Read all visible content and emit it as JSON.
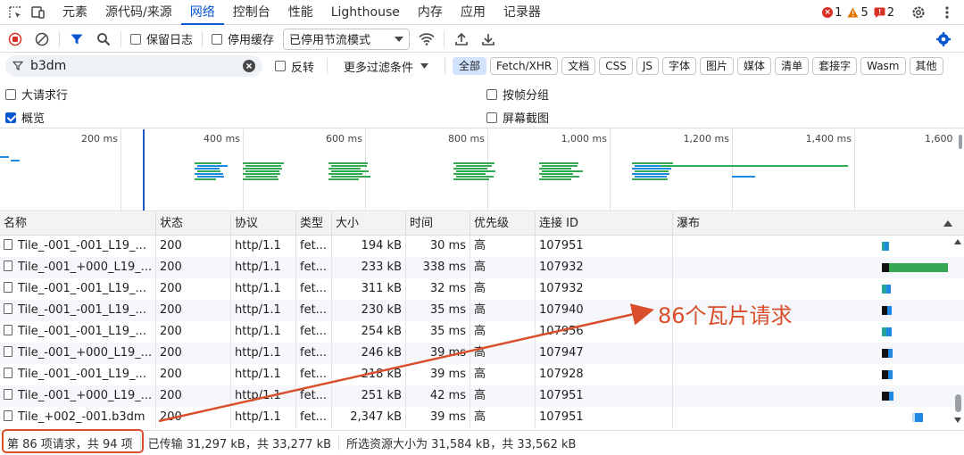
{
  "tabbar": {
    "tabs": [
      {
        "label": "元素"
      },
      {
        "label": "源代码/来源"
      },
      {
        "label": "网络",
        "active": true
      },
      {
        "label": "控制台"
      },
      {
        "label": "性能"
      },
      {
        "label": "Lighthouse"
      },
      {
        "label": "内存"
      },
      {
        "label": "应用"
      },
      {
        "label": "记录器"
      }
    ],
    "errors": "1",
    "warnings": "5",
    "issues": "2",
    "colors": {
      "error": "#d93025",
      "warning": "#e37400",
      "active": "#0b57d0"
    }
  },
  "toolbar": {
    "preserve_log": "保留日志",
    "disable_cache": "停用缓存",
    "throttle": "已停用节流模式"
  },
  "filterbar": {
    "search_value": "b3dm",
    "invert": "反转",
    "more_filters": "更多过滤条件",
    "chips": [
      "全部",
      "Fetch/XHR",
      "文档",
      "CSS",
      "JS",
      "字体",
      "图片",
      "媒体",
      "清单",
      "套接字",
      "Wasm",
      "其他"
    ]
  },
  "options": {
    "large_rows": "大请求行",
    "overview": "概览",
    "group_by_frame": "按帧分组",
    "screenshots": "屏幕截图"
  },
  "overview": {
    "ticks": [
      "200 ms",
      "400 ms",
      "600 ms",
      "800 ms",
      "1,000 ms",
      "1,200 ms",
      "1,400 ms",
      "1,600"
    ]
  },
  "table": {
    "headers": [
      "名称",
      "状态",
      "协议",
      "类型",
      "大小",
      "时间",
      "优先级",
      "连接 ID",
      "瀑布"
    ],
    "rows": [
      {
        "name": "Tile_-001_-001_L19_...",
        "status": "200",
        "protocol": "http/1.1",
        "type": "fet...",
        "size": "194 kB",
        "time": "30 ms",
        "priority": "高",
        "conn": "107951"
      },
      {
        "name": "Tile_-001_+000_L19_...",
        "status": "200",
        "protocol": "http/1.1",
        "type": "fet...",
        "size": "233 kB",
        "time": "338 ms",
        "priority": "高",
        "conn": "107932"
      },
      {
        "name": "Tile_-001_-001_L19_...",
        "status": "200",
        "protocol": "http/1.1",
        "type": "fet...",
        "size": "311 kB",
        "time": "32 ms",
        "priority": "高",
        "conn": "107932"
      },
      {
        "name": "Tile_-001_-001_L19_...",
        "status": "200",
        "protocol": "http/1.1",
        "type": "fet...",
        "size": "230 kB",
        "time": "35 ms",
        "priority": "高",
        "conn": "107940"
      },
      {
        "name": "Tile_-001_-001_L19_...",
        "status": "200",
        "protocol": "http/1.1",
        "type": "fet...",
        "size": "254 kB",
        "time": "35 ms",
        "priority": "高",
        "conn": "107956"
      },
      {
        "name": "Tile_-001_+000_L19_...",
        "status": "200",
        "protocol": "http/1.1",
        "type": "fet...",
        "size": "246 kB",
        "time": "39 ms",
        "priority": "高",
        "conn": "107947"
      },
      {
        "name": "Tile_-001_-001_L19_...",
        "status": "200",
        "protocol": "http/1.1",
        "type": "fet...",
        "size": "218 kB",
        "time": "39 ms",
        "priority": "高",
        "conn": "107928"
      },
      {
        "name": "Tile_-001_+000_L19_...",
        "status": "200",
        "protocol": "http/1.1",
        "type": "fet...",
        "size": "251 kB",
        "time": "42 ms",
        "priority": "高",
        "conn": "107951"
      },
      {
        "name": "Tile_+002_-001.b3dm",
        "status": "200",
        "protocol": "http/1.1",
        "type": "fet...",
        "size": "2,347 kB",
        "time": "39 ms",
        "priority": "高",
        "conn": "107951"
      }
    ]
  },
  "status": {
    "requests": "第 86 项请求，共 94 项",
    "transferred": "已传输 31,297 kB，共 33,277 kB",
    "resources": "所选资源大小为 31,584 kB，共 33,562 kB"
  },
  "annotation": {
    "text": "86个瓦片请求",
    "color": "#d94f2b"
  }
}
